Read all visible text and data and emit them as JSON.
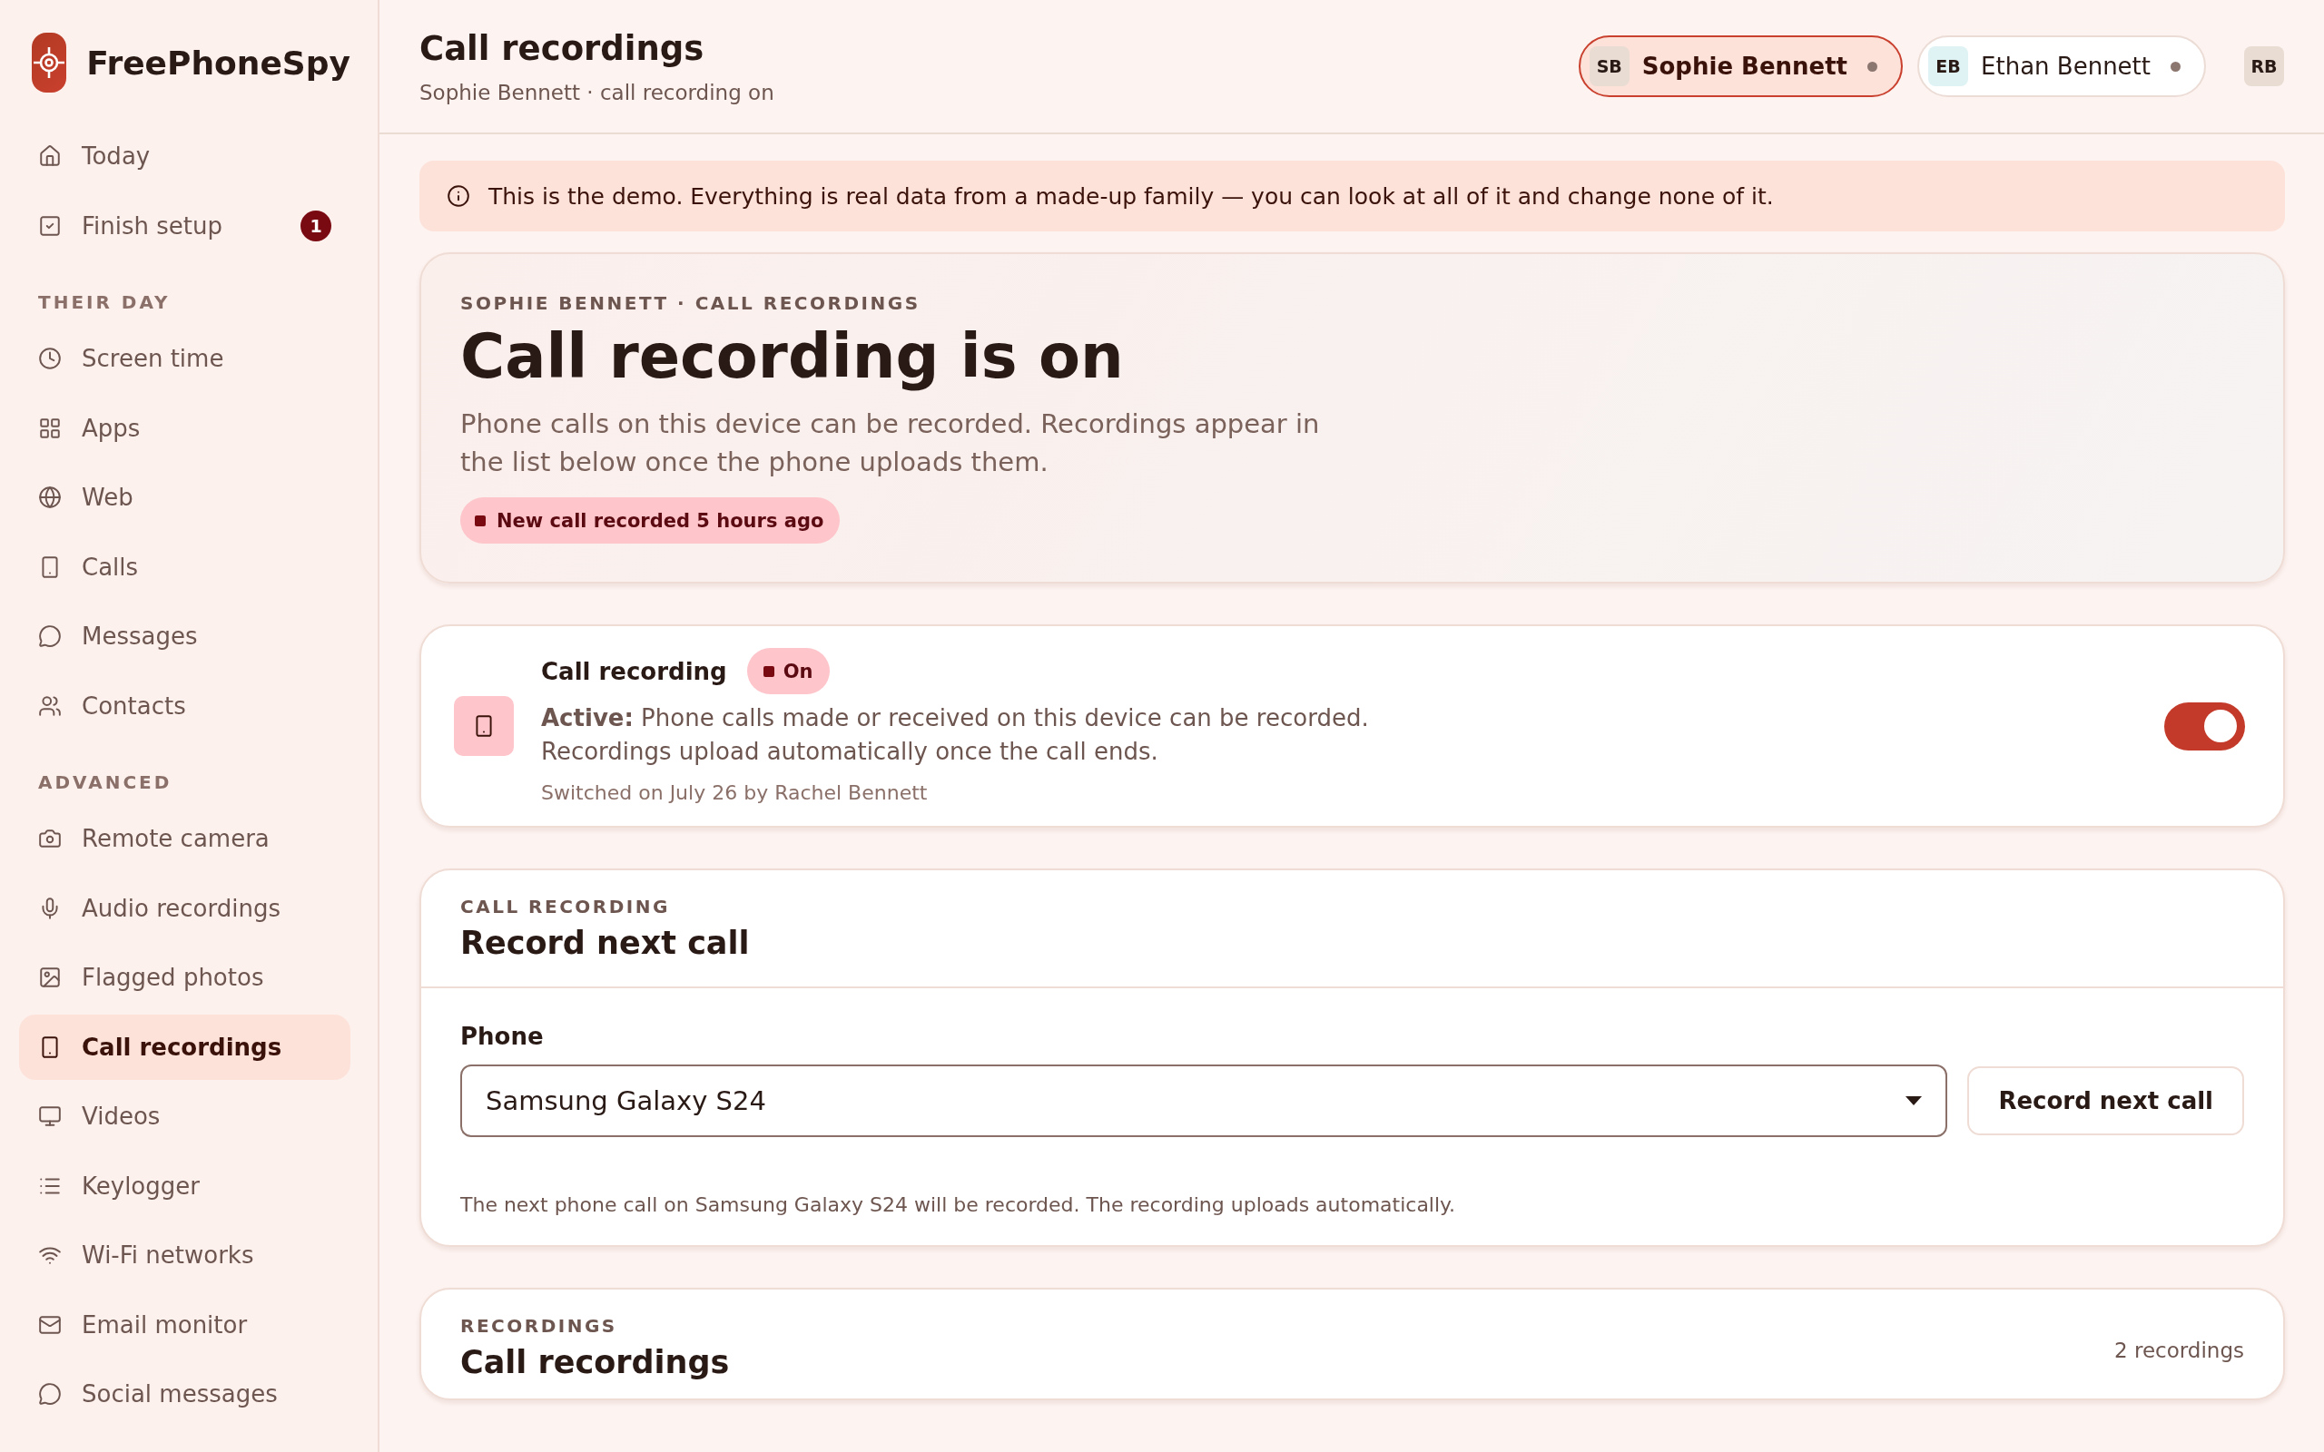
{
  "brand": {
    "name": "FreePhoneSpy"
  },
  "nav": {
    "top": [
      {
        "label": "Today",
        "selected": false
      },
      {
        "label": "Finish setup",
        "selected": false,
        "badge": "1"
      }
    ],
    "sections": [
      {
        "heading": "THEIR DAY",
        "items": [
          {
            "label": "Screen time",
            "selected": false
          },
          {
            "label": "Apps",
            "selected": false
          },
          {
            "label": "Web",
            "selected": false
          },
          {
            "label": "Calls",
            "selected": false
          },
          {
            "label": "Messages",
            "selected": false
          },
          {
            "label": "Contacts",
            "selected": false
          }
        ]
      },
      {
        "heading": "ADVANCED",
        "items": [
          {
            "label": "Remote camera",
            "selected": false
          },
          {
            "label": "Audio recordings",
            "selected": false
          },
          {
            "label": "Flagged photos",
            "selected": false
          },
          {
            "label": "Call recordings",
            "selected": true
          },
          {
            "label": "Videos",
            "selected": false
          },
          {
            "label": "Keylogger",
            "selected": false
          },
          {
            "label": "Wi-Fi networks",
            "selected": false
          },
          {
            "label": "Email monitor",
            "selected": false
          },
          {
            "label": "Social messages",
            "selected": false
          }
        ]
      }
    ]
  },
  "header": {
    "title": "Call recordings",
    "subtitle": "Sophie Bennett · call recording on"
  },
  "profiles": [
    {
      "initials": "SB",
      "name": "Sophie Bennett",
      "selected": true
    },
    {
      "initials": "EB",
      "name": "Ethan Bennett",
      "selected": false
    }
  ],
  "account": {
    "initials": "RB"
  },
  "banner": {
    "text": "This is the demo. Everything is real data from a made-up family — you can look at all of it and change none of it."
  },
  "hero": {
    "eyebrow": "SOPHIE BENNETT · CALL RECORDINGS",
    "title": "Call recording is on",
    "description": "Phone calls on this device can be recorded. Recordings appear in the list below once the phone uploads them.",
    "pill": "New call recorded 5 hours ago"
  },
  "status_card": {
    "title": "Call recording",
    "badge": "On",
    "description": "**Active:** Phone calls made or received on this device can be recorded. Recordings upload automatically once the call ends.",
    "meta": "Switched on July 26 by Rachel Bennett",
    "on": true
  },
  "record_next": {
    "eyebrow": "CALL RECORDING",
    "title": "Record next call",
    "field_label": "Phone",
    "value": "Samsung Galaxy S24",
    "button": "Record next call",
    "help": "The next phone call on Samsung Galaxy S24 will be recorded. The recording uploads automatically."
  },
  "recordings": {
    "eyebrow": "RECORDINGS",
    "title": "Call recordings",
    "count": "2 recordings"
  }
}
